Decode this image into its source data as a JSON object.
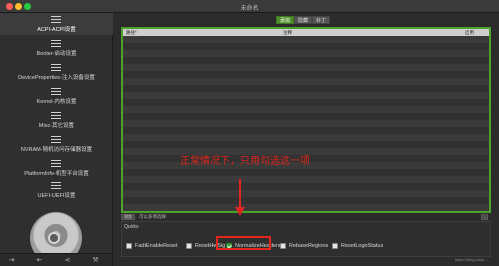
{
  "window": {
    "title": "未命名"
  },
  "sidebar": {
    "items": [
      {
        "label": "ACPI-ACPI设置",
        "active": true
      },
      {
        "label": "Booter-启动设置"
      },
      {
        "label": "DeviceProperties-注入设备设置"
      },
      {
        "label": "Kernel-内核设置"
      },
      {
        "label": "Misc-其它设置"
      },
      {
        "label": "NVRAM-随机访问存储器设置"
      },
      {
        "label": "PlatformInfo-机型平台设置"
      },
      {
        "label": "UEFI-UEFI设置"
      }
    ],
    "bottom_icons": [
      "import-icon",
      "export-icon",
      "share-icon",
      "wrench-icon"
    ]
  },
  "segmented": {
    "tabs": [
      "添加",
      "隐藏",
      "补丁"
    ],
    "selected": "添加"
  },
  "table": {
    "columns": [
      "路径*",
      "注释",
      "启用"
    ],
    "rows": []
  },
  "table_footer": {
    "buttons": [
      "浏览",
      "-"
    ],
    "text": "可以多项选择"
  },
  "quirks": {
    "title": "Quirks",
    "items": [
      {
        "label": "FadtEnableReset",
        "checked": false
      },
      {
        "label": "ResetHwSig",
        "checked": false
      },
      {
        "label": "NormalizeHeaders",
        "checked": true
      },
      {
        "label": "RebaseRegions",
        "checked": false
      },
      {
        "label": "ResetLogoStatus",
        "checked": false
      }
    ]
  },
  "annotation": {
    "text": "正常情况下，只用勾选这一项",
    "color": "#e0261d"
  },
  "colors": {
    "accent_green": "#4ca22a",
    "annotation_red": "#e0261d"
  },
  "watermark": "https://blog.csdn..."
}
